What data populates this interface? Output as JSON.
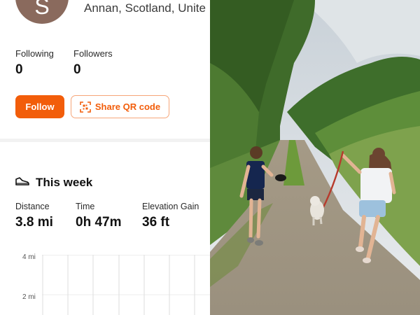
{
  "profile": {
    "avatar_initial": "S",
    "location": "Annan, Scotland, Unite"
  },
  "stats": {
    "following_label": "Following",
    "following_value": "0",
    "followers_label": "Followers",
    "followers_value": "0"
  },
  "actions": {
    "follow_label": "Follow",
    "share_qr_label": "Share QR code"
  },
  "week": {
    "title": "This week",
    "distance_label": "Distance",
    "distance_value": "3.8 mi",
    "time_label": "Time",
    "time_value": "0h 47m",
    "elevation_label": "Elevation Gain",
    "elevation_value": "36 ft"
  },
  "chart": {
    "y_tick_top": "4 mi",
    "y_tick_mid": "2 mi"
  },
  "colors": {
    "accent": "#f25d0a",
    "accent_border": "#f6a679",
    "avatar_bg": "#8a6a5d"
  }
}
